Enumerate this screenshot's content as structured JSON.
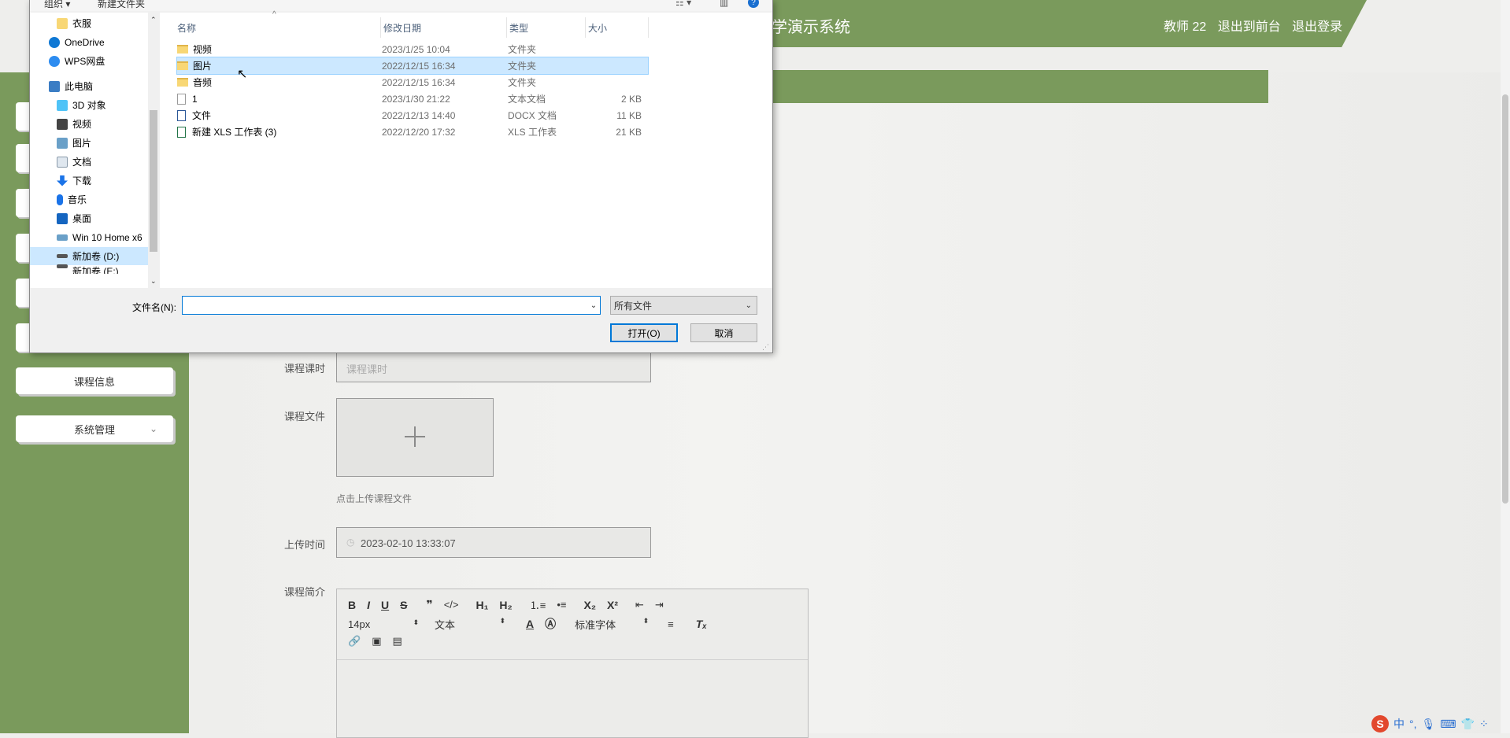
{
  "app": {
    "system_title": "学演示系统",
    "user": {
      "name": "教师 22",
      "front": "退出到前台",
      "logout": "退出登录"
    }
  },
  "sidebar": {
    "course_info": "课程信息",
    "system_mgmt": "系统管理"
  },
  "form": {
    "hours_label": "课程课时",
    "hours_placeholder": "课程课时",
    "file_label": "课程文件",
    "upload_hint": "点击上传课程文件",
    "upload_time_label": "上传时间",
    "upload_time_value": "2023-02-10 13:33:07",
    "intro_label": "课程简介",
    "editor_toolbar": {
      "font_size": "14px",
      "paragraph": "文本",
      "font_family": "标准字体"
    }
  },
  "dialog": {
    "toolbar": {
      "organize": "组织 ▾",
      "new_folder": "新建文件夹"
    },
    "nav": [
      {
        "label": "衣服",
        "icon": "folder-icon"
      },
      {
        "label": "OneDrive",
        "icon": "cloud-icon"
      },
      {
        "label": "WPS网盘",
        "icon": "cloud-icon"
      },
      {
        "label": "此电脑",
        "icon": "computer-icon"
      },
      {
        "label": "3D 对象",
        "icon": "cube-icon"
      },
      {
        "label": "视频",
        "icon": "video-icon"
      },
      {
        "label": "图片",
        "icon": "picture-icon"
      },
      {
        "label": "文档",
        "icon": "document-icon"
      },
      {
        "label": "下载",
        "icon": "download-icon"
      },
      {
        "label": "音乐",
        "icon": "music-icon"
      },
      {
        "label": "桌面",
        "icon": "desktop-icon"
      },
      {
        "label": "Win 10 Home x6",
        "icon": "drive-icon"
      },
      {
        "label": "新加卷 (D:)",
        "icon": "drive-icon"
      },
      {
        "label": "新加卷 (E:)",
        "icon": "drive-icon"
      }
    ],
    "columns": {
      "name": "名称",
      "date": "修改日期",
      "type": "类型",
      "size": "大小"
    },
    "files": [
      {
        "name": "视频",
        "date": "2023/1/25 10:04",
        "type": "文件夹",
        "size": "",
        "kind": "folder"
      },
      {
        "name": "图片",
        "date": "2022/12/15 16:34",
        "type": "文件夹",
        "size": "",
        "kind": "folder"
      },
      {
        "name": "音频",
        "date": "2022/12/15 16:34",
        "type": "文件夹",
        "size": "",
        "kind": "folder"
      },
      {
        "name": "1",
        "date": "2023/1/30 21:22",
        "type": "文本文档",
        "size": "2 KB",
        "kind": "txt"
      },
      {
        "name": "文件",
        "date": "2022/12/13 14:40",
        "type": "DOCX 文档",
        "size": "11 KB",
        "kind": "docx"
      },
      {
        "name": "新建 XLS 工作表 (3)",
        "date": "2022/12/20 17:32",
        "type": "XLS 工作表",
        "size": "21 KB",
        "kind": "xls"
      }
    ],
    "filename_label": "文件名(N):",
    "filename_value": "",
    "filetype_value": "所有文件",
    "open_label": "打开(O)",
    "cancel_label": "取消"
  },
  "tray": {
    "ime": "中"
  }
}
